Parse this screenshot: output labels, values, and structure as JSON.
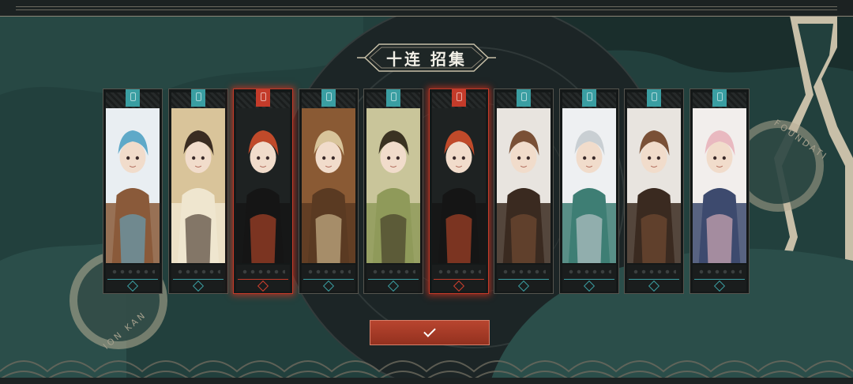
{
  "banner": {
    "title": "十连 招集"
  },
  "results": [
    {
      "rarity": "normal",
      "accent": "#3a9ea2",
      "palette": [
        "#e9eef2",
        "#8a5a3a",
        "#5fa9c8"
      ]
    },
    {
      "rarity": "normal",
      "accent": "#3a9ea2",
      "palette": [
        "#d9c49a",
        "#efe6cf",
        "#3a2c22"
      ]
    },
    {
      "rarity": "rare",
      "accent": "#c43b2a",
      "palette": [
        "#1e2222",
        "#151515",
        "#c04a2a"
      ]
    },
    {
      "rarity": "normal",
      "accent": "#3a9ea2",
      "palette": [
        "#8a5a34",
        "#5a3a22",
        "#d8c49a"
      ]
    },
    {
      "rarity": "normal",
      "accent": "#3a9ea2",
      "palette": [
        "#c9c59a",
        "#8f9a5a",
        "#3a3222"
      ]
    },
    {
      "rarity": "rare",
      "accent": "#c43b2a",
      "palette": [
        "#1e2222",
        "#151515",
        "#c04a2a"
      ]
    },
    {
      "rarity": "normal",
      "accent": "#3a9ea2",
      "palette": [
        "#e8e4df",
        "#3a2a20",
        "#7a5036"
      ]
    },
    {
      "rarity": "normal",
      "accent": "#3a9ea2",
      "palette": [
        "#eef0f2",
        "#3e7e74",
        "#c9cfd3"
      ]
    },
    {
      "rarity": "normal",
      "accent": "#3a9ea2",
      "palette": [
        "#e8e4df",
        "#3a2a20",
        "#7a5036"
      ]
    },
    {
      "rarity": "normal",
      "accent": "#3a9ea2",
      "palette": [
        "#f2eeec",
        "#3d4a6e",
        "#e9b9c0"
      ]
    }
  ],
  "confirm": {
    "icon": "check-icon"
  },
  "seals": {
    "left_text": "ION KAN",
    "right_text": "FOUNDATI"
  },
  "colors": {
    "teal": "#3a9ea2",
    "rare_red": "#c43b2a",
    "background": "#1f3a38"
  }
}
